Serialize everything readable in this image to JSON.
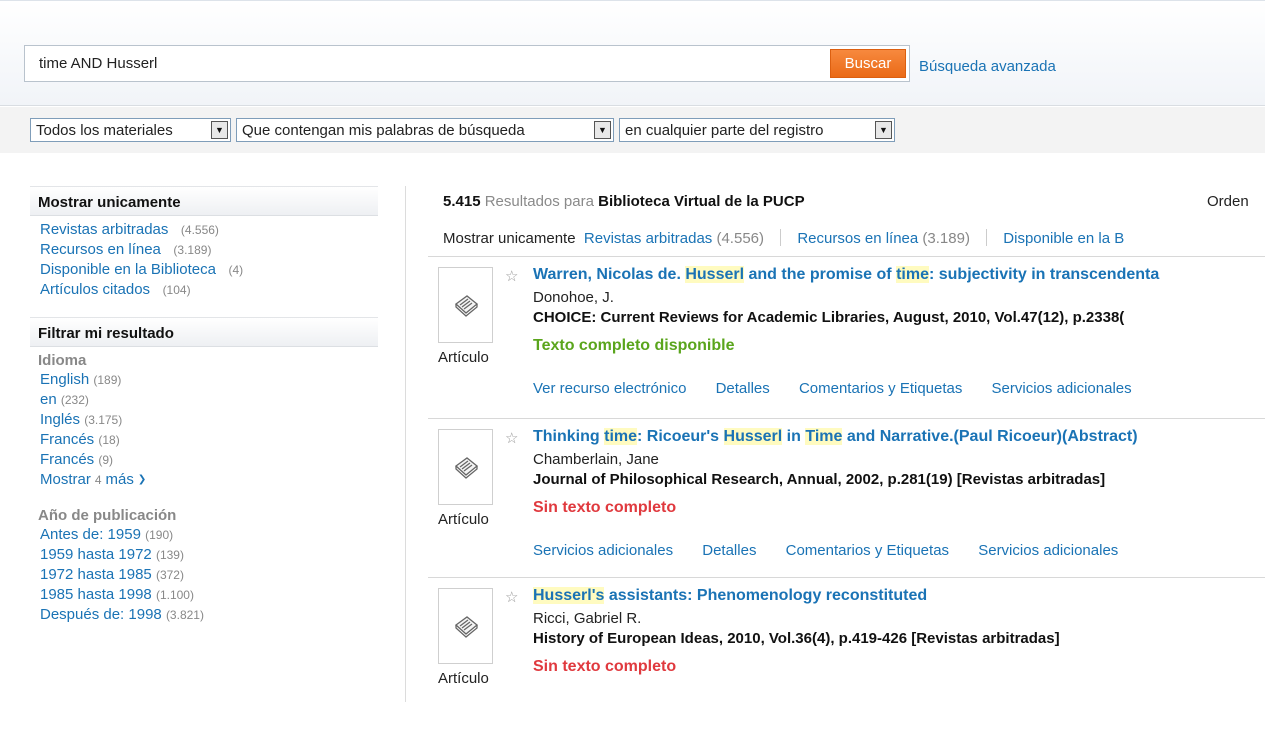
{
  "search": {
    "query": "time AND Husserl",
    "button_label": "Buscar",
    "advanced_label": "Búsqueda avanzada"
  },
  "filters": {
    "material": "Todos los materiales",
    "match": "Que contengan mis palabras de búsqueda",
    "scope": "en cualquier parte del registro"
  },
  "sidebar": {
    "show_only": {
      "title": "Mostrar unicamente",
      "items": [
        {
          "label": "Revistas arbitradas",
          "count": "(4.556)"
        },
        {
          "label": "Recursos en línea",
          "count": "(3.189)"
        },
        {
          "label": "Disponible en la Biblioteca",
          "count": "(4)"
        },
        {
          "label": "Artículos citados",
          "count": "(104)"
        }
      ]
    },
    "refine": {
      "title": "Filtrar mi resultado",
      "language": {
        "title": "Idioma",
        "items": [
          {
            "label": "English",
            "count": "(189)"
          },
          {
            "label": "en",
            "count": "(232)"
          },
          {
            "label": "Inglés",
            "count": "(3.175)"
          },
          {
            "label": "Francés",
            "count": "(18)"
          },
          {
            "label": "Francés",
            "count": "(9)"
          }
        ],
        "more_prefix": "Mostrar",
        "more_count": "4",
        "more_suffix": "más"
      },
      "year": {
        "title": "Año de publicación",
        "items": [
          {
            "label": "Antes de: 1959",
            "count": "(190)"
          },
          {
            "label": "1959 hasta 1972",
            "count": "(139)"
          },
          {
            "label": "1972 hasta 1985",
            "count": "(372)"
          },
          {
            "label": "1985 hasta 1998",
            "count": "(1.100)"
          },
          {
            "label": "Después de: 1998",
            "count": "(3.821)"
          }
        ]
      }
    }
  },
  "results": {
    "count": "5.415",
    "for_text": "Resultados para",
    "library": "Biblioteca Virtual de la PUCP",
    "order_label": "Orden",
    "facet_bar": {
      "label": "Mostrar unicamente",
      "items": [
        {
          "label": "Revistas arbitradas",
          "count": "(4.556)"
        },
        {
          "label": "Recursos en línea",
          "count": "(3.189)"
        },
        {
          "label": "Disponible en la B",
          "count": ""
        }
      ]
    },
    "items": [
      {
        "type": "Artículo",
        "title": {
          "t1": "Warren, Nicolas de. ",
          "h1": "Husserl",
          "t2": " and the promise of ",
          "h2": "time",
          "t3": ": subjectivity in transcendenta",
          "h3": "",
          "t4": ""
        },
        "author": "Donohoe, J.",
        "source": "CHOICE: Current Reviews for Academic Libraries, August, 2010, Vol.47(12), p.2338(",
        "availability": "Texto completo disponible",
        "availability_color": "#5aa51c",
        "links": [
          "Ver recurso electrónico",
          "Detalles",
          "Comentarios y Etiquetas",
          "Servicios adicionales"
        ]
      },
      {
        "type": "Artículo",
        "title": {
          "t1": "Thinking ",
          "h1": "time",
          "t2": ": Ricoeur's ",
          "h2": "Husserl",
          "t3": " in ",
          "h3": "Time",
          "t4": " and Narrative.(Paul Ricoeur)(Abstract)"
        },
        "author": "Chamberlain, Jane",
        "source": "Journal of Philosophical Research, Annual, 2002, p.281(19) [Revistas arbitradas]",
        "availability": "Sin texto completo",
        "availability_color": "#e0393e",
        "links": [
          "Servicios adicionales",
          "Detalles",
          "Comentarios y Etiquetas",
          "Servicios adicionales"
        ]
      },
      {
        "type": "Artículo",
        "title": {
          "t1": "",
          "h1": "Husserl's",
          "t2": " assistants: Phenomenology reconstituted",
          "h2": "",
          "t3": "",
          "h3": "",
          "t4": ""
        },
        "author": "Ricci, Gabriel R.",
        "source": "History of European Ideas, 2010, Vol.36(4), p.419-426 [Revistas arbitradas]",
        "availability": "Sin texto completo",
        "availability_color": "#e0393e",
        "links": []
      }
    ]
  },
  "colors": {
    "link": "#1a73b5",
    "accent_button": "#f07a2a",
    "highlight": "#fffbc0"
  },
  "icons": [
    "star-icon",
    "document-icon",
    "chevron-down-icon",
    "dropdown-arrow-icon"
  ]
}
